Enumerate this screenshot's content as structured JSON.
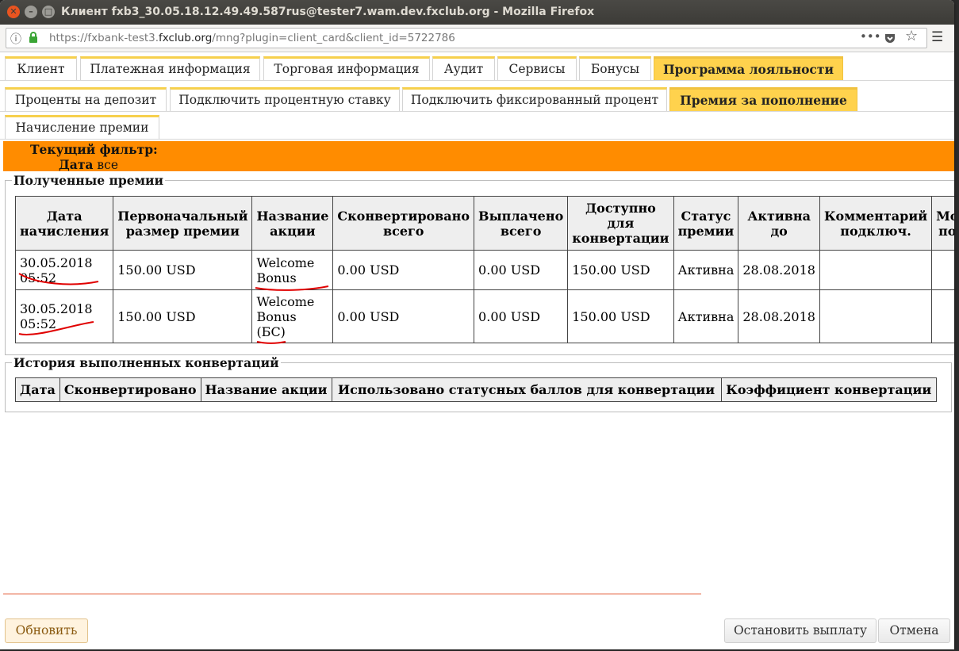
{
  "window": {
    "title": "Клиент fxb3_30.05.18.12.49.49.587rus@tester7.wam.dev.fxclub.org - Mozilla Firefox",
    "url_prefix": "https://fxbank-test3.",
    "url_domain": "fxclub.org",
    "url_path": "/mng?plugin=client_card&client_id=5722786",
    "controls": {
      "close": "✕",
      "minimize": "–",
      "maximize": "□"
    }
  },
  "tabs_row1": [
    "Клиент",
    "Платежная информация",
    "Торговая информация",
    "Аудит",
    "Сервисы",
    "Бонусы",
    "Программа лояльности"
  ],
  "tabs_row2": [
    "Проценты на депозит",
    "Подключить процентную ставку",
    "Подключить фиксированный процент",
    "Премия за пополнение"
  ],
  "tabs_row3": [
    "Начисление премии"
  ],
  "filter": {
    "label": "Текущий фильтр:",
    "field": "Дата",
    "value": "все"
  },
  "received": {
    "legend": "Полученные премии",
    "headers": [
      "Дата начисления",
      "Первоначальный размер премии",
      "Название акции",
      "Сконвертировано всего",
      "Выплачено всего",
      "Доступно для конвертации",
      "Статус премии",
      "Активна до",
      "Комментарий подключ.",
      "Мо по"
    ],
    "rows": [
      [
        "30.05.2018 05:52",
        "150.00 USD",
        "Welcome Bonus",
        "0.00 USD",
        "0.00 USD",
        "150.00 USD",
        "Активна",
        "28.08.2018",
        "",
        ""
      ],
      [
        "30.05.2018 05:52",
        "150.00 USD",
        "Welcome Bonus (БС)",
        "0.00 USD",
        "0.00 USD",
        "150.00 USD",
        "Активна",
        "28.08.2018",
        "",
        ""
      ]
    ]
  },
  "history": {
    "legend": "История выполненных конвертаций",
    "headers": [
      "Дата",
      "Сконвертировано",
      "Название акции",
      "Использовано статусных баллов для конвертации",
      "Коэффициент конвертации"
    ]
  },
  "buttons": {
    "refresh": "Обновить",
    "stop_payment": "Остановить выплату",
    "cancel": "Отмена"
  },
  "icons": [
    "info-icon",
    "lock-icon",
    "more-icon",
    "pocket-icon",
    "star-icon",
    "menu-icon"
  ],
  "colors": {
    "filter_bg": "#ff8c00",
    "tab_accent": "#ffd24d",
    "annotation": "#e00000"
  }
}
